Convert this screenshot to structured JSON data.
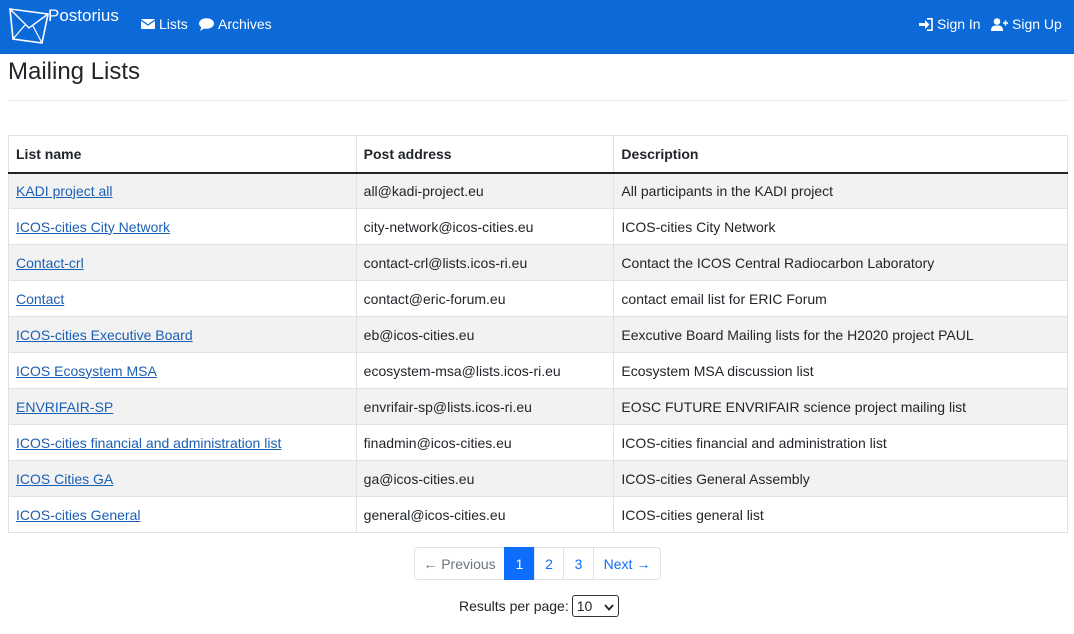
{
  "navbar": {
    "brand": "Postorius",
    "links": [
      {
        "label": "Lists",
        "icon": "envelope-icon"
      },
      {
        "label": "Archives",
        "icon": "comment-icon"
      }
    ],
    "auth": [
      {
        "label": "Sign In",
        "icon": "sign-in-icon"
      },
      {
        "label": "Sign Up",
        "icon": "user-plus-icon"
      }
    ],
    "color": "#0b69d8"
  },
  "page": {
    "title": "Mailing Lists"
  },
  "table": {
    "headers": [
      "List name",
      "Post address",
      "Description"
    ],
    "rows": [
      {
        "name": "KADI project all",
        "address": "all@kadi-project.eu",
        "description": "All participants in the KADI project"
      },
      {
        "name": "ICOS-cities City Network",
        "address": "city-network@icos-cities.eu",
        "description": "ICOS-cities City Network"
      },
      {
        "name": "Contact-crl",
        "address": "contact-crl@lists.icos-ri.eu",
        "description": "Contact the ICOS Central Radiocarbon Laboratory"
      },
      {
        "name": "Contact",
        "address": "contact@eric-forum.eu",
        "description": "contact email list for ERIC Forum"
      },
      {
        "name": "ICOS-cities Executive Board",
        "address": "eb@icos-cities.eu",
        "description": "Eexcutive Board Mailing lists for the H2020 project PAUL"
      },
      {
        "name": "ICOS Ecosystem MSA",
        "address": "ecosystem-msa@lists.icos-ri.eu",
        "description": "Ecosystem MSA discussion list"
      },
      {
        "name": "ENVRIFAIR-SP",
        "address": "envrifair-sp@lists.icos-ri.eu",
        "description": "EOSC FUTURE ENVRIFAIR science project mailing list"
      },
      {
        "name": "ICOS-cities financial and administration list",
        "address": "finadmin@icos-cities.eu",
        "description": "ICOS-cities financial and administration list"
      },
      {
        "name": "ICOS Cities GA",
        "address": "ga@icos-cities.eu",
        "description": "ICOS-cities General Assembly"
      },
      {
        "name": "ICOS-cities General",
        "address": "general@icos-cities.eu",
        "description": "ICOS-cities general list"
      }
    ]
  },
  "pagination": {
    "previous": "← Previous",
    "pages": [
      "1",
      "2",
      "3"
    ],
    "current": "1",
    "next": "Next →"
  },
  "per_page": {
    "label": "Results per page:",
    "value": "10"
  }
}
